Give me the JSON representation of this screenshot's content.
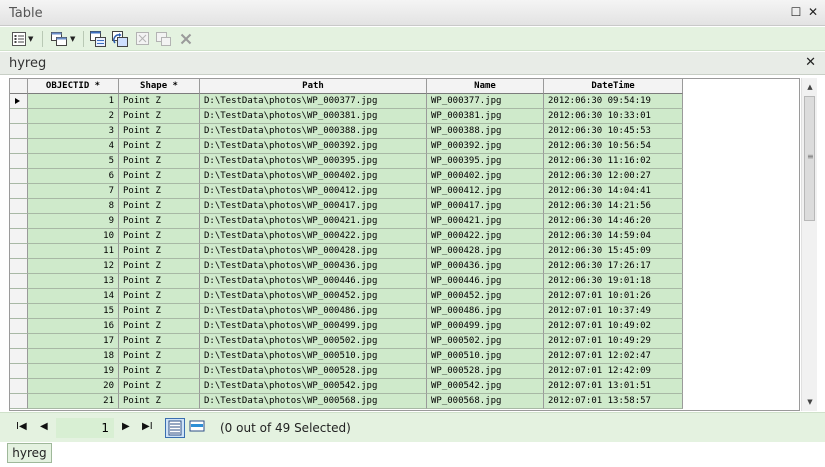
{
  "window": {
    "title": "Table",
    "restore_glyph": "☐",
    "close_glyph": "✕"
  },
  "toolbar": {
    "icons": [
      "table-options-icon",
      "related-tables-icon",
      "select-by-attributes-icon",
      "switch-selection-icon",
      "clear-selection-icon",
      "zoom-to-selected-icon",
      "delete-selected-icon"
    ]
  },
  "tab": {
    "name": "hyreg",
    "close_glyph": "✕"
  },
  "table": {
    "columns": [
      "OBJECTID *",
      "Shape *",
      "Path",
      "Name",
      "DateTime"
    ],
    "rows": [
      [
        "1",
        "Point Z",
        "D:\\TestData\\photos\\WP_000377.jpg",
        "WP_000377.jpg",
        "2012:06:30 09:54:19"
      ],
      [
        "2",
        "Point Z",
        "D:\\TestData\\photos\\WP_000381.jpg",
        "WP_000381.jpg",
        "2012:06:30 10:33:01"
      ],
      [
        "3",
        "Point Z",
        "D:\\TestData\\photos\\WP_000388.jpg",
        "WP_000388.jpg",
        "2012:06:30 10:45:53"
      ],
      [
        "4",
        "Point Z",
        "D:\\TestData\\photos\\WP_000392.jpg",
        "WP_000392.jpg",
        "2012:06:30 10:56:54"
      ],
      [
        "5",
        "Point Z",
        "D:\\TestData\\photos\\WP_000395.jpg",
        "WP_000395.jpg",
        "2012:06:30 11:16:02"
      ],
      [
        "6",
        "Point Z",
        "D:\\TestData\\photos\\WP_000402.jpg",
        "WP_000402.jpg",
        "2012:06:30 12:00:27"
      ],
      [
        "7",
        "Point Z",
        "D:\\TestData\\photos\\WP_000412.jpg",
        "WP_000412.jpg",
        "2012:06:30 14:04:41"
      ],
      [
        "8",
        "Point Z",
        "D:\\TestData\\photos\\WP_000417.jpg",
        "WP_000417.jpg",
        "2012:06:30 14:21:56"
      ],
      [
        "9",
        "Point Z",
        "D:\\TestData\\photos\\WP_000421.jpg",
        "WP_000421.jpg",
        "2012:06:30 14:46:20"
      ],
      [
        "10",
        "Point Z",
        "D:\\TestData\\photos\\WP_000422.jpg",
        "WP_000422.jpg",
        "2012:06:30 14:59:04"
      ],
      [
        "11",
        "Point Z",
        "D:\\TestData\\photos\\WP_000428.jpg",
        "WP_000428.jpg",
        "2012:06:30 15:45:09"
      ],
      [
        "12",
        "Point Z",
        "D:\\TestData\\photos\\WP_000436.jpg",
        "WP_000436.jpg",
        "2012:06:30 17:26:17"
      ],
      [
        "13",
        "Point Z",
        "D:\\TestData\\photos\\WP_000446.jpg",
        "WP_000446.jpg",
        "2012:06:30 19:01:18"
      ],
      [
        "14",
        "Point Z",
        "D:\\TestData\\photos\\WP_000452.jpg",
        "WP_000452.jpg",
        "2012:07:01 10:01:26"
      ],
      [
        "15",
        "Point Z",
        "D:\\TestData\\photos\\WP_000486.jpg",
        "WP_000486.jpg",
        "2012:07:01 10:37:49"
      ],
      [
        "16",
        "Point Z",
        "D:\\TestData\\photos\\WP_000499.jpg",
        "WP_000499.jpg",
        "2012:07:01 10:49:02"
      ],
      [
        "17",
        "Point Z",
        "D:\\TestData\\photos\\WP_000502.jpg",
        "WP_000502.jpg",
        "2012:07:01 10:49:29"
      ],
      [
        "18",
        "Point Z",
        "D:\\TestData\\photos\\WP_000510.jpg",
        "WP_000510.jpg",
        "2012:07:01 12:02:47"
      ],
      [
        "19",
        "Point Z",
        "D:\\TestData\\photos\\WP_000528.jpg",
        "WP_000528.jpg",
        "2012:07:01 12:42:09"
      ],
      [
        "20",
        "Point Z",
        "D:\\TestData\\photos\\WP_000542.jpg",
        "WP_000542.jpg",
        "2012:07:01 13:01:51"
      ],
      [
        "21",
        "Point Z",
        "D:\\TestData\\photos\\WP_000568.jpg",
        "WP_000568.jpg",
        "2012:07:01 13:58:57"
      ]
    ],
    "row_fill_color": "#cfeacb"
  },
  "navigation": {
    "first_glyph": "I◀",
    "prev_glyph": "◀",
    "current_record": "1",
    "next_glyph": "▶",
    "last_glyph": "▶I",
    "selection_status": "(0 out of 49 Selected)"
  },
  "bottom_tab": {
    "label": "hyreg"
  }
}
